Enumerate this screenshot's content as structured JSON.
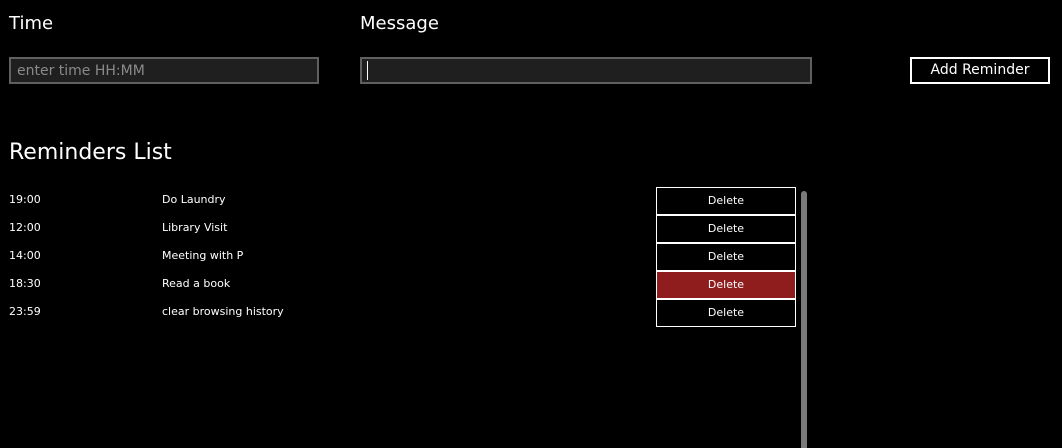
{
  "form": {
    "time_label": "Time",
    "time_placeholder": "enter time HH:MM",
    "time_value": "",
    "message_label": "Message",
    "message_value": "",
    "add_button_label": "Add Reminder"
  },
  "list": {
    "title": "Reminders List",
    "reminders": [
      {
        "time": "19:00",
        "message": "Do Laundry",
        "delete_label": "Delete"
      },
      {
        "time": "12:00",
        "message": "Library Visit",
        "delete_label": "Delete"
      },
      {
        "time": "14:00",
        "message": "Meeting with P",
        "delete_label": "Delete"
      },
      {
        "time": "18:30",
        "message": "Read a book",
        "delete_label": "Delete",
        "hovered": true
      },
      {
        "time": "23:59",
        "message": "clear browsing history",
        "delete_label": "Delete"
      }
    ]
  },
  "colors": {
    "background": "#000000",
    "delete_hover": "#8f1d1d",
    "input_border": "#5f5f5f",
    "scrollbar": "#7a7a7a"
  }
}
